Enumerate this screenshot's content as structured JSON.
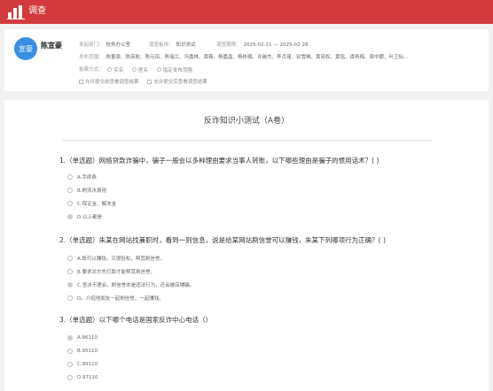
{
  "app": {
    "title": "调查"
  },
  "user": {
    "avatar_text": "宣豪",
    "name": "陈宣豪"
  },
  "meta": {
    "dept_label": "发起部门：",
    "dept_value": "校务办公室",
    "module_label": "调查板块：",
    "module_value": "知识测试",
    "period_label": "调查期限：",
    "period_value": "2025-02-21 — 2025-02-28",
    "scope_label": "发布范围：",
    "scope_value": "陈董豪、陈亮航、陈元琼、陈瑞兰、冯嘉林、黄薇、杨嘉昌、杨彬楠、许碳杰、李贞瑾、钦雪琳、黄亮权、黄铭、谭青梅、梁中娜、叶卫仙...",
    "vote_label": "投票方式：",
    "vote_options": [
      "实名",
      "匿名",
      "指定发布范围"
    ],
    "checks": [
      "允许提交前查看调查结果",
      "允许提交后查看调查结果"
    ]
  },
  "quiz": {
    "title": "反诈知识小测试（A卷）",
    "questions": [
      {
        "text": "1.（单选题）网络贷款诈骗中，骗子一般会以多种理由要求当事人转账，以下哪些理由是骗子的惯用话术？( )",
        "options": [
          "A.手续费",
          "B.刷流水费用",
          "C.保证金、解冻金",
          "D.以上都是"
        ],
        "selected": 3
      },
      {
        "text": "2.（单选题）朱某在网站找兼职时，看到一则信息，说是给某网站刷信誉可以赚钱，朱某下列哪项行为正确？( )",
        "options": [
          "A.既可以赚钱，又很轻松，帮其刷信誉。",
          "B.要求对方先打款才能帮其刷信誉。",
          "C.坚决不理会，刷信誉本是违法行为，还会被店铺骗。",
          "D。介绍他朋友一起刷信誉，一起赚钱。"
        ],
        "selected": 2
      },
      {
        "text": "3.（单选题）以下哪个电话是国家反诈中心电话（）",
        "options": [
          "A.96110",
          "B.95110",
          "C.99110",
          "D.97110"
        ],
        "selected": 0
      }
    ]
  }
}
